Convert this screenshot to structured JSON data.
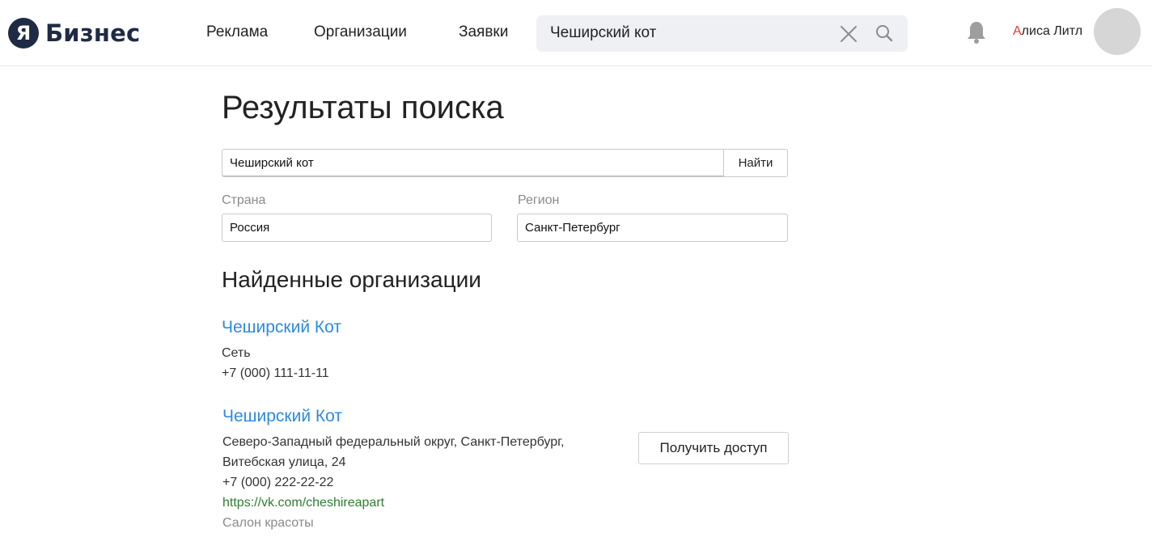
{
  "header": {
    "logo_letter": "Я",
    "logo_text": "Бизнес",
    "nav": [
      {
        "label": "Реклама"
      },
      {
        "label": "Организации"
      },
      {
        "label": "Заявки"
      }
    ],
    "search_value": "Чеширский кот",
    "user": {
      "first": "А",
      "rest": "лиса Литл"
    }
  },
  "main": {
    "title": "Результаты поиска",
    "search": {
      "value": "Чеширский кот",
      "button": "Найти"
    },
    "country": {
      "label": "Страна",
      "value": "Россия"
    },
    "region": {
      "label": "Регион",
      "value": "Санкт-Петербург"
    },
    "section_title": "Найденные организации",
    "organizations": [
      {
        "name": "Чеширский Кот",
        "type": "Сеть",
        "phone": "+7 (000) 111-11-11"
      },
      {
        "name": "Чеширский Кот",
        "address_line1": "Северо-Западный федеральный округ, Санкт-Петербург,",
        "address_line2": "Витебская улица, 24",
        "phone": "+7 (000) 222-22-22",
        "url": "https://vk.com/cheshireapart",
        "category": "Салон красоты",
        "action": "Получить доступ"
      }
    ]
  },
  "colors": {
    "link": "#2d8ae0",
    "url": "#2e7d32",
    "logo": "#1f2a44"
  }
}
